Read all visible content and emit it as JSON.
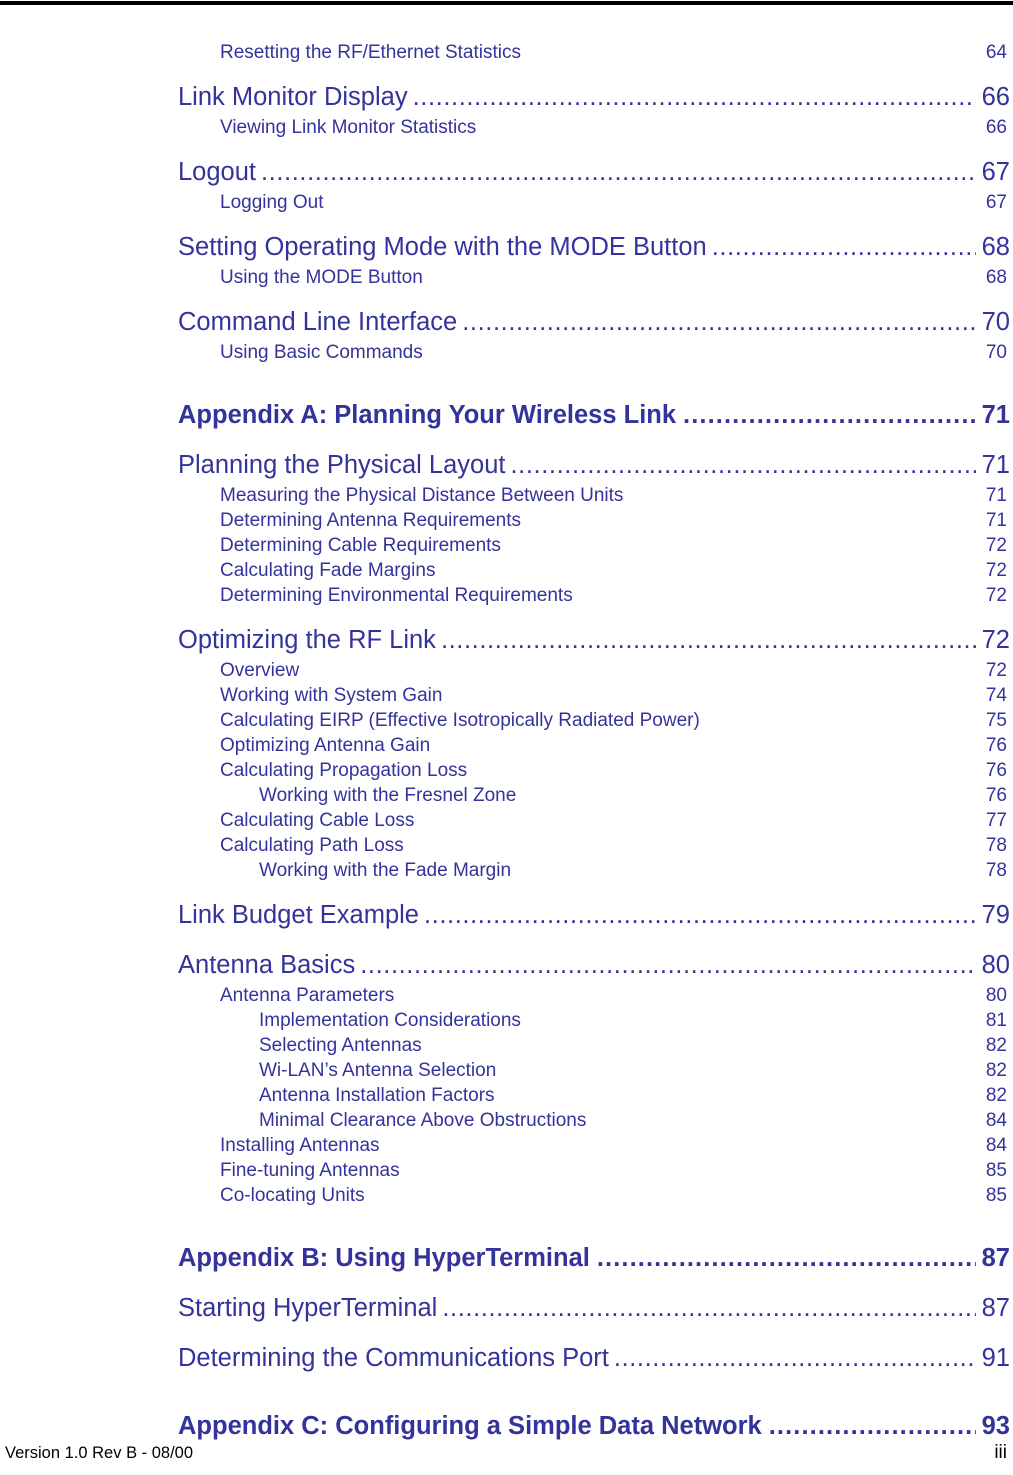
{
  "colors": {
    "heading_blue": "#33339B",
    "rule_black": "#000000",
    "footer_black": "#000000"
  },
  "footer": {
    "version": "Version 1.0 Rev B - 08/00",
    "folio": "iii"
  },
  "toc": {
    "entries": [
      {
        "level": 2,
        "title": "Resetting the RF/Ethernet Statistics",
        "page": "64",
        "gap": "none"
      },
      {
        "level": 1,
        "title": "Link Monitor Display",
        "page": "66",
        "gap": "md"
      },
      {
        "level": 2,
        "title": "Viewing Link Monitor Statistics",
        "page": "66",
        "gap": "none"
      },
      {
        "level": 1,
        "title": "Logout",
        "page": "67",
        "gap": "md"
      },
      {
        "level": 2,
        "title": "Logging Out",
        "page": "67",
        "gap": "none"
      },
      {
        "level": 1,
        "title": "Setting Operating Mode with the MODE Button",
        "page": "68",
        "gap": "md"
      },
      {
        "level": 2,
        "title": "Using the MODE Button",
        "page": "68",
        "gap": "none"
      },
      {
        "level": 1,
        "title": "Command Line Interface",
        "page": "70",
        "gap": "md"
      },
      {
        "level": 2,
        "title": "Using Basic Commands",
        "page": "70",
        "gap": "none"
      },
      {
        "level": 0,
        "title": "Appendix A: Planning Your Wireless Link",
        "page": "71",
        "gap": "lg"
      },
      {
        "level": 1,
        "title": "Planning the Physical Layout",
        "page": "71",
        "gap": "md"
      },
      {
        "level": 2,
        "title": "Measuring the Physical Distance Between Units",
        "page": "71",
        "gap": "none"
      },
      {
        "level": 2,
        "title": "Determining Antenna Requirements",
        "page": "71",
        "gap": "none"
      },
      {
        "level": 2,
        "title": "Determining Cable Requirements",
        "page": "72",
        "gap": "none"
      },
      {
        "level": 2,
        "title": "Calculating Fade Margins",
        "page": "72",
        "gap": "none"
      },
      {
        "level": 2,
        "title": "Determining Environmental Requirements",
        "page": "72",
        "gap": "none"
      },
      {
        "level": 1,
        "title": "Optimizing the RF Link",
        "page": "72",
        "gap": "md"
      },
      {
        "level": 2,
        "title": "Overview",
        "page": "72",
        "gap": "none"
      },
      {
        "level": 2,
        "title": "Working with System Gain",
        "page": "74",
        "gap": "none"
      },
      {
        "level": 2,
        "title": "Calculating EIRP (Effective Isotropically Radiated Power)",
        "page": "75",
        "gap": "none"
      },
      {
        "level": 2,
        "title": "Optimizing Antenna Gain",
        "page": "76",
        "gap": "none"
      },
      {
        "level": 2,
        "title": "Calculating Propagation Loss",
        "page": "76",
        "gap": "none"
      },
      {
        "level": 3,
        "title": "Working with the Fresnel Zone",
        "page": "76",
        "gap": "none"
      },
      {
        "level": 2,
        "title": "Calculating Cable Loss",
        "page": "77",
        "gap": "none"
      },
      {
        "level": 2,
        "title": "Calculating Path Loss",
        "page": "78",
        "gap": "none"
      },
      {
        "level": 3,
        "title": "Working with the Fade Margin",
        "page": "78",
        "gap": "none"
      },
      {
        "level": 1,
        "title": "Link Budget Example",
        "page": "79",
        "gap": "md"
      },
      {
        "level": 1,
        "title": "Antenna Basics",
        "page": "80",
        "gap": "md"
      },
      {
        "level": 2,
        "title": "Antenna Parameters",
        "page": "80",
        "gap": "none"
      },
      {
        "level": 3,
        "title": "Implementation Considerations",
        "page": "81",
        "gap": "none"
      },
      {
        "level": 3,
        "title": "Selecting Antennas",
        "page": "82",
        "gap": "none"
      },
      {
        "level": 3,
        "title": "Wi-LAN’s Antenna Selection",
        "page": "82",
        "gap": "none"
      },
      {
        "level": 3,
        "title": "Antenna Installation Factors",
        "page": "82",
        "gap": "none"
      },
      {
        "level": 3,
        "title": "Minimal Clearance Above Obstructions",
        "page": "84",
        "gap": "none"
      },
      {
        "level": 2,
        "title": "Installing Antennas",
        "page": "84",
        "gap": "none"
      },
      {
        "level": 2,
        "title": "Fine-tuning Antennas",
        "page": "85",
        "gap": "none"
      },
      {
        "level": 2,
        "title": "Co-locating Units",
        "page": "85",
        "gap": "none"
      },
      {
        "level": 0,
        "title": "Appendix B: Using HyperTerminal",
        "page": "87",
        "gap": "lg"
      },
      {
        "level": 1,
        "title": "Starting HyperTerminal",
        "page": "87",
        "gap": "md"
      },
      {
        "level": 1,
        "title": "Determining the Communications Port",
        "page": "91",
        "gap": "md"
      },
      {
        "level": 0,
        "title": "Appendix C: Configuring a Simple Data Network",
        "page": "93",
        "gap": "lg"
      }
    ],
    "leader_char": "."
  }
}
